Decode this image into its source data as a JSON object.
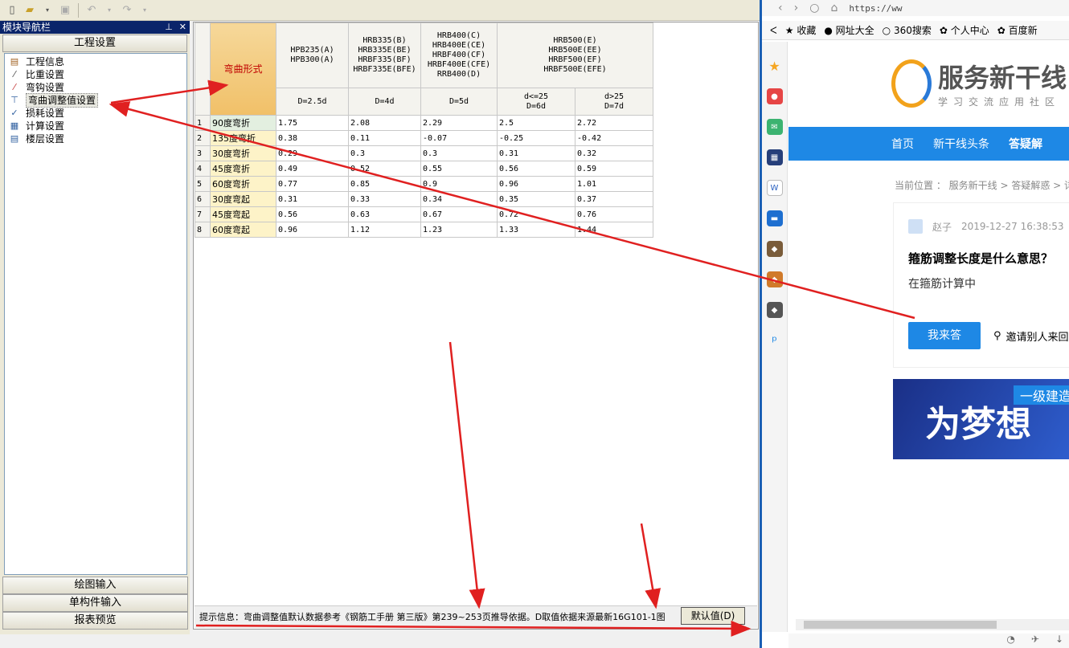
{
  "nav": {
    "title": "模块导航栏",
    "section": "工程设置",
    "items": [
      "工程信息",
      "比重设置",
      "弯钩设置",
      "弯曲调整值设置",
      "损耗设置",
      "计算设置",
      "楼层设置"
    ],
    "bottom_tabs": [
      "绘图输入",
      "单构件输入",
      "报表预览"
    ]
  },
  "grid": {
    "bend_header": "弯曲形式",
    "groups": [
      {
        "lines": [
          "HPB235(A)",
          "HPB300(A)"
        ]
      },
      {
        "lines": [
          "HRB335(B)",
          "HRB335E(BE)",
          "HRBF335(BF)",
          "HRBF335E(BFE)"
        ]
      },
      {
        "lines": [
          "HRB400(C)",
          "HRB400E(CE)",
          "HRBF400(CF)",
          "HRBF400E(CFE)",
          "RRB400(D)"
        ]
      },
      {
        "lines": [
          "HRB500(E)",
          "HRB500E(EE)",
          "HRBF500(EF)",
          "HRBF500E(EFE)"
        ]
      }
    ],
    "subheaders": [
      {
        "lines": [
          "D=2.5d"
        ]
      },
      {
        "lines": [
          "D=4d"
        ]
      },
      {
        "lines": [
          "D=5d"
        ]
      },
      {
        "lines": [
          "d<=25",
          "D=6d"
        ]
      },
      {
        "lines": [
          "d>25",
          "D=7d"
        ]
      }
    ],
    "rows": [
      {
        "n": "1",
        "name": "90度弯折",
        "v": [
          "1.75",
          "2.08",
          "2.29",
          "2.5",
          "2.72"
        ]
      },
      {
        "n": "2",
        "name": "135度弯折",
        "v": [
          "0.38",
          "0.11",
          "-0.07",
          "-0.25",
          "-0.42"
        ]
      },
      {
        "n": "3",
        "name": "30度弯折",
        "v": [
          "0.29",
          "0.3",
          "0.3",
          "0.31",
          "0.32"
        ]
      },
      {
        "n": "4",
        "name": "45度弯折",
        "v": [
          "0.49",
          "0.52",
          "0.55",
          "0.56",
          "0.59"
        ]
      },
      {
        "n": "5",
        "name": "60度弯折",
        "v": [
          "0.77",
          "0.85",
          "0.9",
          "0.96",
          "1.01"
        ]
      },
      {
        "n": "6",
        "name": "30度弯起",
        "v": [
          "0.31",
          "0.33",
          "0.34",
          "0.35",
          "0.37"
        ]
      },
      {
        "n": "7",
        "name": "45度弯起",
        "v": [
          "0.56",
          "0.63",
          "0.67",
          "0.72",
          "0.76"
        ]
      },
      {
        "n": "8",
        "name": "60度弯起",
        "v": [
          "0.96",
          "1.12",
          "1.23",
          "1.33",
          "1.44"
        ]
      }
    ]
  },
  "hint": "提示信息：弯曲调整值默认数据参考《钢筋工手册 第三版》第239~253页推导依据。D取值依据来源最新16G101-1图",
  "default_button": "默认值(D)",
  "browser": {
    "url": "https://ww",
    "favorites": [
      "收藏",
      "网址大全",
      "360搜索",
      "个人中心",
      "百度新"
    ],
    "logo_text": "服务新干线",
    "logo_sub": "学习交流应用社区",
    "nav": [
      "首页",
      "新干线头条",
      "答疑解"
    ],
    "breadcrumb": "当前位置 ： 服务新干线 > 答疑解惑 > 详",
    "author": "赵子",
    "date": "2019-12-27 16:38:53",
    "question": "箍筋调整长度是什么意思？",
    "body": "在箍筋计算中",
    "answer_button": "我来答",
    "invite": "邀请别人来回",
    "banner_main": "为梦想",
    "banner_tag": "一级建造"
  },
  "colors": {
    "accent": "#1e88e5",
    "annotation": "#e02020",
    "title_bar": "#0a246a"
  }
}
